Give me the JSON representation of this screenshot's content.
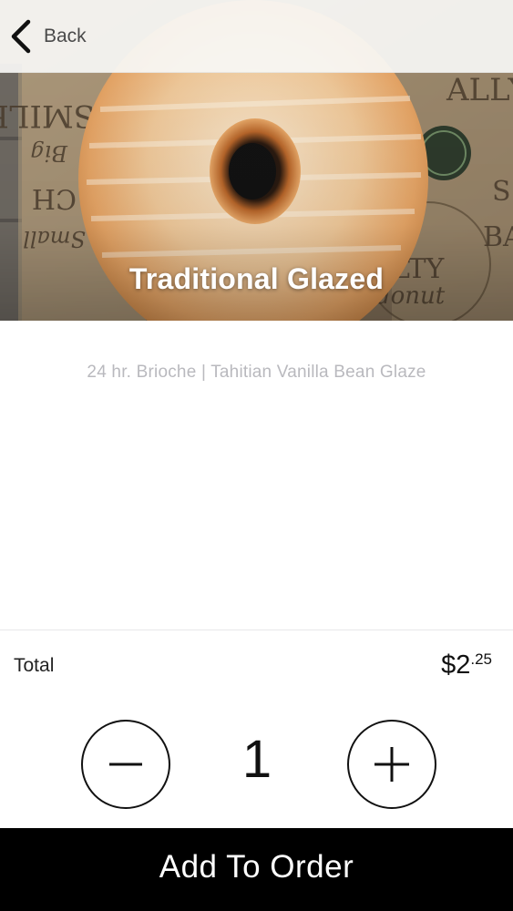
{
  "nav": {
    "back_label": "Back"
  },
  "product": {
    "name": "Traditional Glazed",
    "description": "24 hr. Brioche | Tahitian Vanilla Bean Glaze",
    "photo_background_text": [
      "SMILE",
      "Big",
      "CH",
      "Small",
      "LTY",
      "donut",
      "ALLY",
      "BA",
      "S"
    ]
  },
  "order": {
    "total_label": "Total",
    "price_main": "$2",
    "price_cents": ".25",
    "quantity": "1",
    "decrease_icon": "minus-icon",
    "increase_icon": "plus-icon",
    "add_button_label": "Add To Order"
  },
  "colors": {
    "navbar_bg": "#f8f7f5",
    "description_text": "#b9b9be",
    "add_button_bg": "#000000",
    "add_button_text": "#ffffff"
  }
}
